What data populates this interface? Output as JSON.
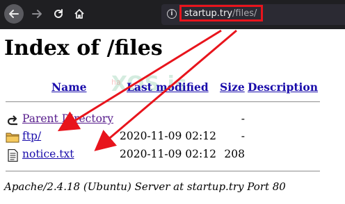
{
  "browser": {
    "url_host": "startup.try",
    "url_path": "/files/",
    "highlight_color": "#e8141c"
  },
  "page": {
    "title": "Index of /files",
    "columns": {
      "name": "Name",
      "last_modified": "Last modified",
      "size": "Size",
      "description": "Description"
    },
    "rows": [
      {
        "icon": "parent-directory-icon",
        "name": "Parent Directory",
        "date": "",
        "size": "-"
      },
      {
        "icon": "folder-icon",
        "name": "ftp/",
        "date": "2020-11-09 02:12",
        "size": "-"
      },
      {
        "icon": "text-file-icon",
        "name": "notice.txt",
        "date": "2020-11-09 02:12",
        "size": "208"
      }
    ],
    "footer": "Apache/2.4.18 (Ubuntu) Server at startup.try Port 80"
  },
  "watermark": {
    "main": "XOS.is",
    "small": "ha"
  },
  "colors": {
    "link": "#1a0dab",
    "visited": "#551a8b",
    "annotation_arrow": "#e8141c"
  }
}
